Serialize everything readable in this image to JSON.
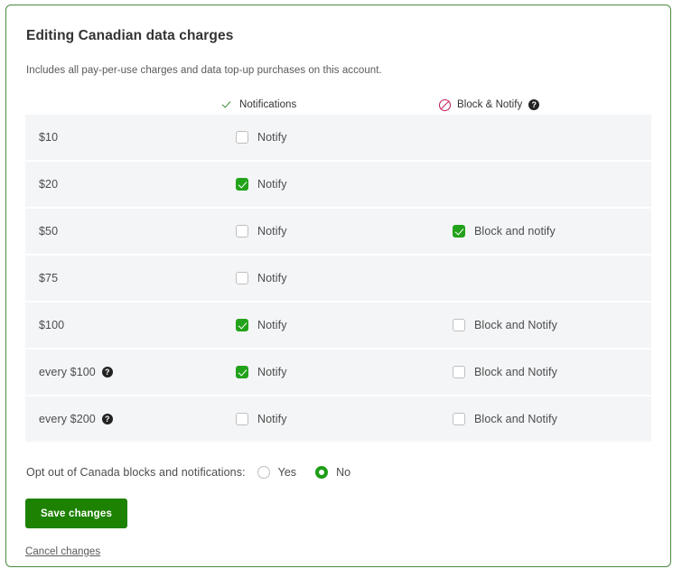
{
  "card": {
    "title": "Editing Canadian data charges",
    "subtitle": "Includes all pay-per-use charges and data top-up purchases on this account.",
    "border_color": "#4a8b3f"
  },
  "table": {
    "headers": {
      "amount": "",
      "notifications": "Notifications",
      "block_notify": "Block & Notify",
      "block_notify_help": "?",
      "check_icon": "check-icon",
      "ban_icon": "ban-icon"
    },
    "rows": [
      {
        "amount": "$10",
        "has_help": false,
        "help": "?",
        "notify_label": "Notify",
        "notify_checked": false,
        "has_block": false,
        "block_label": "",
        "block_checked": false
      },
      {
        "amount": "$20",
        "has_help": false,
        "help": "?",
        "notify_label": "Notify",
        "notify_checked": true,
        "has_block": false,
        "block_label": "",
        "block_checked": false
      },
      {
        "amount": "$50",
        "has_help": false,
        "help": "?",
        "notify_label": "Notify",
        "notify_checked": false,
        "has_block": true,
        "block_label": "Block and notify",
        "block_checked": true
      },
      {
        "amount": "$75",
        "has_help": false,
        "help": "?",
        "notify_label": "Notify",
        "notify_checked": false,
        "has_block": false,
        "block_label": "",
        "block_checked": false
      },
      {
        "amount": "$100",
        "has_help": false,
        "help": "?",
        "notify_label": "Notify",
        "notify_checked": true,
        "has_block": true,
        "block_label": "Block and Notify",
        "block_checked": false
      },
      {
        "amount": "every $100",
        "has_help": true,
        "help": "?",
        "notify_label": "Notify",
        "notify_checked": true,
        "has_block": true,
        "block_label": "Block and Notify",
        "block_checked": false
      },
      {
        "amount": "every $200",
        "has_help": true,
        "help": "?",
        "notify_label": "Notify",
        "notify_checked": false,
        "has_block": true,
        "block_label": "Block and Notify",
        "block_checked": false
      }
    ]
  },
  "optout": {
    "label": "Opt out of Canada blocks and notifications:",
    "options": [
      {
        "label": "Yes",
        "selected": false
      },
      {
        "label": "No",
        "selected": true
      }
    ]
  },
  "actions": {
    "save_label": "Save changes",
    "cancel_label": "Cancel changes",
    "save_color": "#1d8102"
  }
}
